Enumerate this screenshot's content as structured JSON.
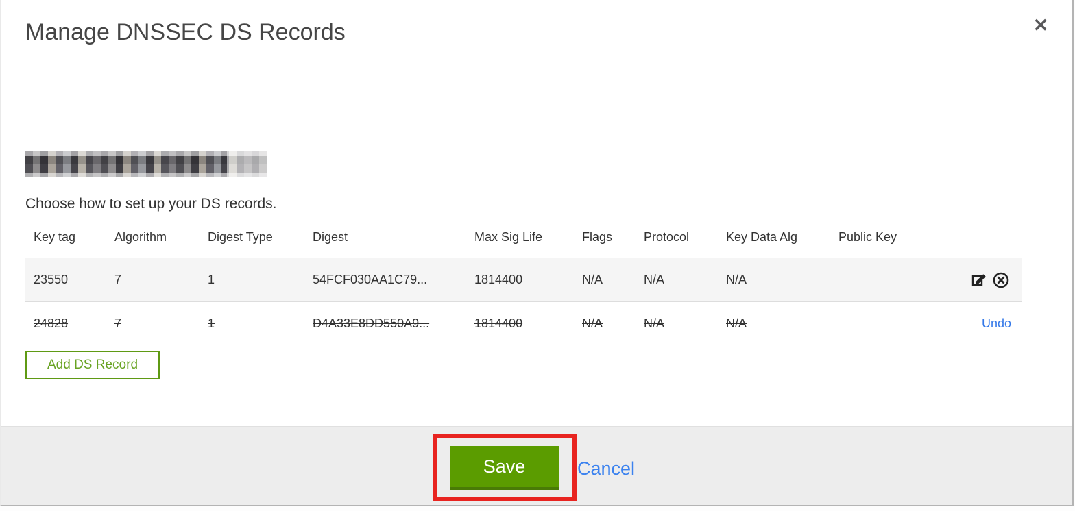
{
  "dialog": {
    "title": "Manage DNSSEC DS Records",
    "close_glyph": "✕",
    "subtitle": "Choose how to set up your DS records."
  },
  "table": {
    "headers": [
      "Key tag",
      "Algorithm",
      "Digest Type",
      "Digest",
      "Max Sig Life",
      "Flags",
      "Protocol",
      "Key Data Alg",
      "Public Key"
    ],
    "rows": [
      {
        "key_tag": "23550",
        "algorithm": "7",
        "digest_type": "1",
        "digest": "54FCF030AA1C79...",
        "max_sig_life": "1814400",
        "flags": "N/A",
        "protocol": "N/A",
        "key_data_alg": "N/A",
        "public_key": "",
        "state": "active"
      },
      {
        "key_tag": "24828",
        "algorithm": "7",
        "digest_type": "1",
        "digest": "D4A33E8DD550A9...",
        "max_sig_life": "1814400",
        "flags": "N/A",
        "protocol": "N/A",
        "key_data_alg": "N/A",
        "public_key": "",
        "state": "deleted",
        "action_label": "Undo"
      }
    ]
  },
  "buttons": {
    "add_ds_record": "Add DS Record",
    "save": "Save",
    "cancel": "Cancel"
  },
  "colors": {
    "accent_green": "#5b9c00",
    "outline_green": "#5f9a14",
    "link_blue": "#3b82ef",
    "annotation_red": "#e82420",
    "row_gray": "#f5f5f5",
    "footer_gray": "#ededed"
  }
}
